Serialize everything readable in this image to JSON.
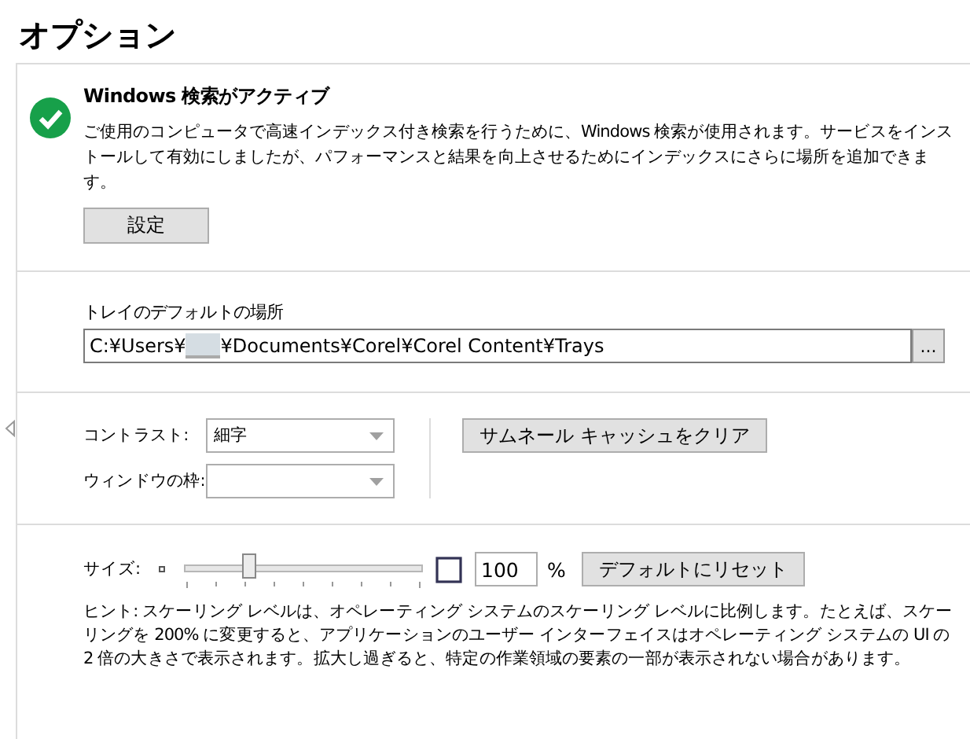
{
  "title": "オプション",
  "search": {
    "heading": "Windows 検索がアクティブ",
    "active": true,
    "description": "ご使用のコンピュータで高速インデックス付き検索を行うために、Windows 検索が使用されます。サービスをインストールして有効にしましたが、パフォーマンスと結果を向上させるためにインデックスにさらに場所を追加できます。",
    "button": "設定"
  },
  "tray": {
    "label": "トレイのデフォルトの場所",
    "path_start": "C:¥Users¥",
    "redacted": true,
    "path_end": "¥Documents¥Corel¥Corel Content¥Trays",
    "browse": "..."
  },
  "display": {
    "contrast_label": "コントラスト:",
    "contrast_value": "細字",
    "frame_label": "ウィンドウの枠:",
    "clear_button": "サムネール キャッシュをクリア"
  },
  "size": {
    "label": "サイズ:",
    "level": 0.26,
    "value": "100",
    "unit": "%",
    "reset_button": "デフォルトにリセット",
    "hint": "ヒント: スケーリング レベルは、オペレーティング システムのスケーリング レベルに比例します。たとえば、スケーリングを 200% に変更すると、アプリケーションのユーザー インターフェイスはオペレーティング システムの UI の 2 倍の大きさで表示されます。拡大し過ぎると、特定の作業領域の要素の一部が表示されない場合があります。"
  }
}
